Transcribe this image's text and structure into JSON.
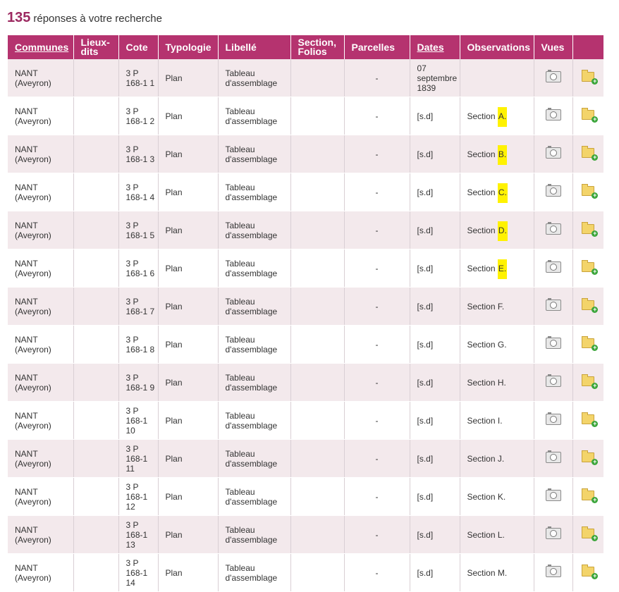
{
  "results": {
    "count": "135",
    "label": "réponses à votre recherche"
  },
  "columns": {
    "communes": "Communes",
    "lieux_dits": "Lieux-dits",
    "cote": "Cote",
    "typologie": "Typologie",
    "libelle": "Libellé",
    "section": "Section, Folios",
    "parcelles": "Parcelles",
    "dates": "Dates",
    "observations": "Observations",
    "vues": "Vues"
  },
  "icons": {
    "view": "camera-icon",
    "add": "folder-add-icon"
  },
  "colors": {
    "header_bg": "#b5336f",
    "count": "#9c2a61",
    "row_alt": "#f3e9ec",
    "highlight": "#fff200"
  },
  "rows": [
    {
      "commune": "NANT (Aveyron)",
      "lieux": "",
      "cote": "3 P 168-1 1",
      "typ": "Plan",
      "lib": "Tableau d'assemblage",
      "sec": "",
      "parc": "-",
      "date": "07 septembre 1839",
      "obs_pre": "",
      "obs_hl": "",
      "obs_post": ""
    },
    {
      "commune": "NANT (Aveyron)",
      "lieux": "",
      "cote": "3 P 168-1 2",
      "typ": "Plan",
      "lib": "Tableau d'assemblage",
      "sec": "",
      "parc": "-",
      "date": "[s.d]",
      "obs_pre": "Section ",
      "obs_hl": "A.",
      "obs_post": ""
    },
    {
      "commune": "NANT (Aveyron)",
      "lieux": "",
      "cote": "3 P 168-1 3",
      "typ": "Plan",
      "lib": "Tableau d'assemblage",
      "sec": "",
      "parc": "-",
      "date": "[s.d]",
      "obs_pre": "Section ",
      "obs_hl": "B.",
      "obs_post": ""
    },
    {
      "commune": "NANT (Aveyron)",
      "lieux": "",
      "cote": "3 P 168-1 4",
      "typ": "Plan",
      "lib": "Tableau d'assemblage",
      "sec": "",
      "parc": "-",
      "date": "[s.d]",
      "obs_pre": "Section ",
      "obs_hl": "C.",
      "obs_post": ""
    },
    {
      "commune": "NANT (Aveyron)",
      "lieux": "",
      "cote": "3 P 168-1 5",
      "typ": "Plan",
      "lib": "Tableau d'assemblage",
      "sec": "",
      "parc": "-",
      "date": "[s.d]",
      "obs_pre": "Section ",
      "obs_hl": "D.",
      "obs_post": ""
    },
    {
      "commune": "NANT (Aveyron)",
      "lieux": "",
      "cote": "3 P 168-1 6",
      "typ": "Plan",
      "lib": "Tableau d'assemblage",
      "sec": "",
      "parc": "-",
      "date": "[s.d]",
      "obs_pre": "Section ",
      "obs_hl": "E.",
      "obs_post": ""
    },
    {
      "commune": "NANT (Aveyron)",
      "lieux": "",
      "cote": "3 P 168-1 7",
      "typ": "Plan",
      "lib": "Tableau d'assemblage",
      "sec": "",
      "parc": "-",
      "date": "[s.d]",
      "obs_pre": "Section F.",
      "obs_hl": "",
      "obs_post": ""
    },
    {
      "commune": "NANT (Aveyron)",
      "lieux": "",
      "cote": "3 P 168-1 8",
      "typ": "Plan",
      "lib": "Tableau d'assemblage",
      "sec": "",
      "parc": "-",
      "date": "[s.d]",
      "obs_pre": "Section G.",
      "obs_hl": "",
      "obs_post": ""
    },
    {
      "commune": "NANT (Aveyron)",
      "lieux": "",
      "cote": "3 P 168-1 9",
      "typ": "Plan",
      "lib": "Tableau d'assemblage",
      "sec": "",
      "parc": "-",
      "date": "[s.d]",
      "obs_pre": "Section H.",
      "obs_hl": "",
      "obs_post": ""
    },
    {
      "commune": "NANT (Aveyron)",
      "lieux": "",
      "cote": "3 P 168-1 10",
      "typ": "Plan",
      "lib": "Tableau d'assemblage",
      "sec": "",
      "parc": "-",
      "date": "[s.d]",
      "obs_pre": "Section I.",
      "obs_hl": "",
      "obs_post": ""
    },
    {
      "commune": "NANT (Aveyron)",
      "lieux": "",
      "cote": "3 P 168-1 11",
      "typ": "Plan",
      "lib": "Tableau d'assemblage",
      "sec": "",
      "parc": "-",
      "date": "[s.d]",
      "obs_pre": "Section J.",
      "obs_hl": "",
      "obs_post": ""
    },
    {
      "commune": "NANT (Aveyron)",
      "lieux": "",
      "cote": "3 P 168-1 12",
      "typ": "Plan",
      "lib": "Tableau d'assemblage",
      "sec": "",
      "parc": "-",
      "date": "[s.d]",
      "obs_pre": "Section K.",
      "obs_hl": "",
      "obs_post": ""
    },
    {
      "commune": "NANT (Aveyron)",
      "lieux": "",
      "cote": "3 P 168-1 13",
      "typ": "Plan",
      "lib": "Tableau d'assemblage",
      "sec": "",
      "parc": "-",
      "date": "[s.d]",
      "obs_pre": "Section L.",
      "obs_hl": "",
      "obs_post": ""
    },
    {
      "commune": "NANT (Aveyron)",
      "lieux": "",
      "cote": "3 P 168-1 14",
      "typ": "Plan",
      "lib": "Tableau d'assemblage",
      "sec": "",
      "parc": "-",
      "date": "[s.d]",
      "obs_pre": "Section M.",
      "obs_hl": "",
      "obs_post": ""
    }
  ]
}
